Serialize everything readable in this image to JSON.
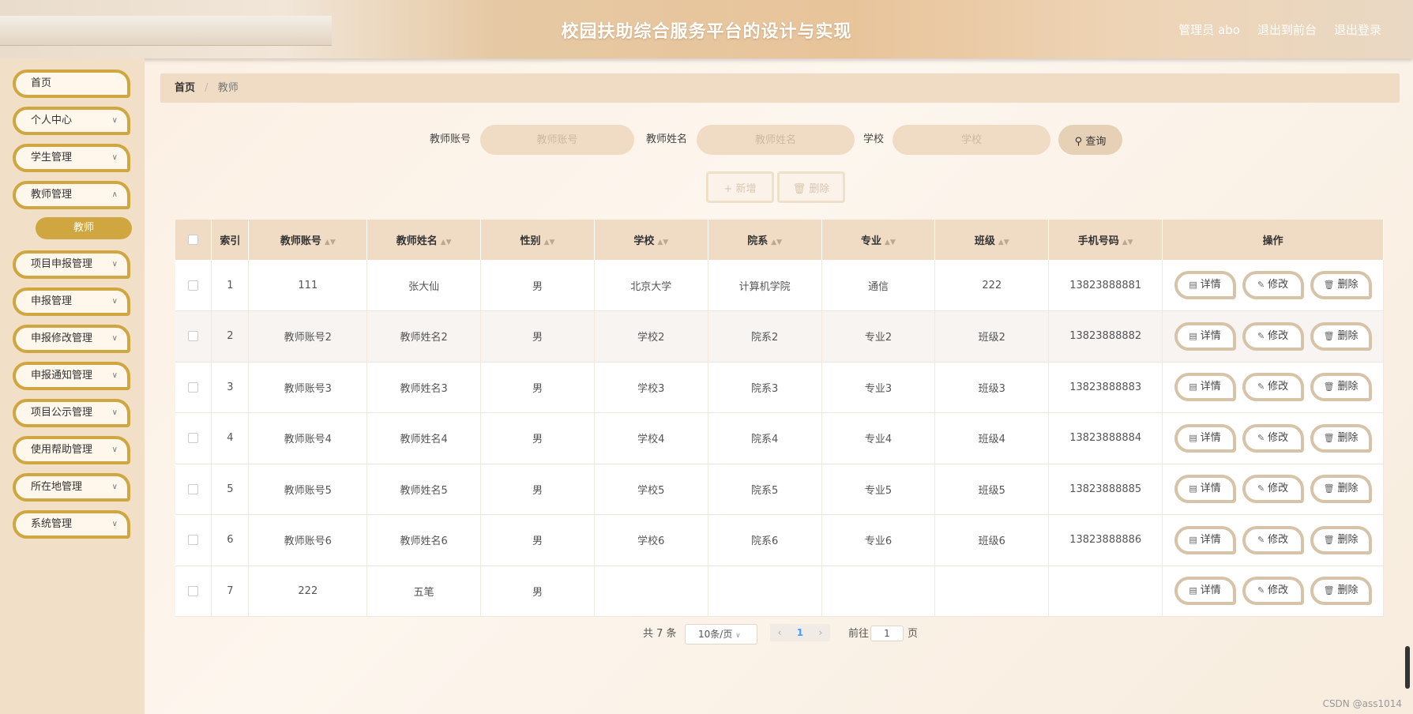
{
  "header": {
    "title": "校园扶助综合服务平台的设计与实现",
    "admin_label": "管理员 abo",
    "back_front": "退出到前台",
    "logout": "退出登录"
  },
  "sidebar": {
    "items": [
      {
        "label": "首页"
      },
      {
        "label": "个人中心"
      },
      {
        "label": "学生管理"
      },
      {
        "label": "教师管理"
      },
      {
        "label": "项目申报管理"
      },
      {
        "label": "申报管理"
      },
      {
        "label": "申报修改管理"
      },
      {
        "label": "申报通知管理"
      },
      {
        "label": "项目公示管理"
      },
      {
        "label": "使用帮助管理"
      },
      {
        "label": "所在地管理"
      },
      {
        "label": "系统管理"
      }
    ],
    "active_sub": "教师"
  },
  "breadcrumb": {
    "home": "首页",
    "separator": "/",
    "current": "教师"
  },
  "search": {
    "account_label": "教师账号",
    "account_placeholder": "教师账号",
    "name_label": "教师姓名",
    "name_placeholder": "教师姓名",
    "school_label": "学校",
    "school_placeholder": "学校",
    "query_label": "查询"
  },
  "actions": {
    "add_label": "新增",
    "delete_label": "删除"
  },
  "table": {
    "columns": [
      "索引",
      "教师账号",
      "教师姓名",
      "性别",
      "学校",
      "院系",
      "专业",
      "班级",
      "手机号码",
      "操作"
    ],
    "rows": [
      {
        "idx": "1",
        "account": "111",
        "name": "张大仙",
        "gender": "男",
        "school": "北京大学",
        "dept": "计算机学院",
        "major": "通信",
        "class": "222",
        "phone": "13823888881"
      },
      {
        "idx": "2",
        "account": "教师账号2",
        "name": "教师姓名2",
        "gender": "男",
        "school": "学校2",
        "dept": "院系2",
        "major": "专业2",
        "class": "班级2",
        "phone": "13823888882"
      },
      {
        "idx": "3",
        "account": "教师账号3",
        "name": "教师姓名3",
        "gender": "男",
        "school": "学校3",
        "dept": "院系3",
        "major": "专业3",
        "class": "班级3",
        "phone": "13823888883"
      },
      {
        "idx": "4",
        "account": "教师账号4",
        "name": "教师姓名4",
        "gender": "男",
        "school": "学校4",
        "dept": "院系4",
        "major": "专业4",
        "class": "班级4",
        "phone": "13823888884"
      },
      {
        "idx": "5",
        "account": "教师账号5",
        "name": "教师姓名5",
        "gender": "男",
        "school": "学校5",
        "dept": "院系5",
        "major": "专业5",
        "class": "班级5",
        "phone": "13823888885"
      },
      {
        "idx": "6",
        "account": "教师账号6",
        "name": "教师姓名6",
        "gender": "男",
        "school": "学校6",
        "dept": "院系6",
        "major": "专业6",
        "class": "班级6",
        "phone": "13823888886"
      },
      {
        "idx": "7",
        "account": "222",
        "name": "五笔",
        "gender": "男",
        "school": "",
        "dept": "",
        "major": "",
        "class": "",
        "phone": ""
      }
    ],
    "row_buttons": {
      "detail": "详情",
      "edit": "修改",
      "delete": "删除"
    }
  },
  "pagination": {
    "total_text": "共 7 条",
    "page_size": "10条/页",
    "current_page": "1",
    "goto_label": "前往",
    "goto_value": "1",
    "page_unit": "页"
  },
  "watermark": "CSDN @ass1014",
  "colors": {
    "accent": "#cfa63f",
    "header_bg": "#e8c49a",
    "table_header": "#f0dcc4",
    "link_blue": "#409eff"
  }
}
